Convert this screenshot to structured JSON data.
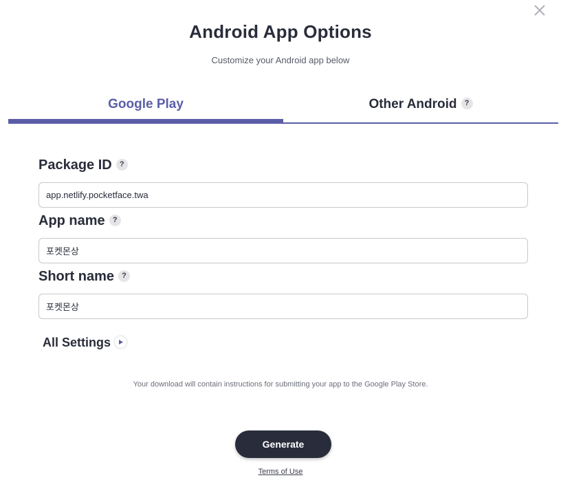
{
  "dialog": {
    "title": "Android App Options",
    "subtitle": "Customize your Android app below",
    "close_icon": "close-icon"
  },
  "tabs": [
    {
      "label": "Google Play",
      "active": true
    },
    {
      "label": "Other Android",
      "active": false,
      "help_icon": "?"
    }
  ],
  "fields": {
    "package_id": {
      "label": "Package ID",
      "help": "?",
      "value": "app.netlify.pocketface.twa"
    },
    "app_name": {
      "label": "App name",
      "help": "?",
      "value": "포켓몬상"
    },
    "short_name": {
      "label": "Short name",
      "help": "?",
      "value": "포켓몬상"
    }
  },
  "all_settings": {
    "label": "All Settings",
    "icon": "chevron-right-icon"
  },
  "note": "Your download will contain instructions for submitting your app to the Google Play Store.",
  "generate_label": "Generate",
  "terms_label": "Terms of Use",
  "colors": {
    "accent": "#5b5ea6",
    "dark": "#292c3a",
    "border": "#c8c8cc"
  }
}
